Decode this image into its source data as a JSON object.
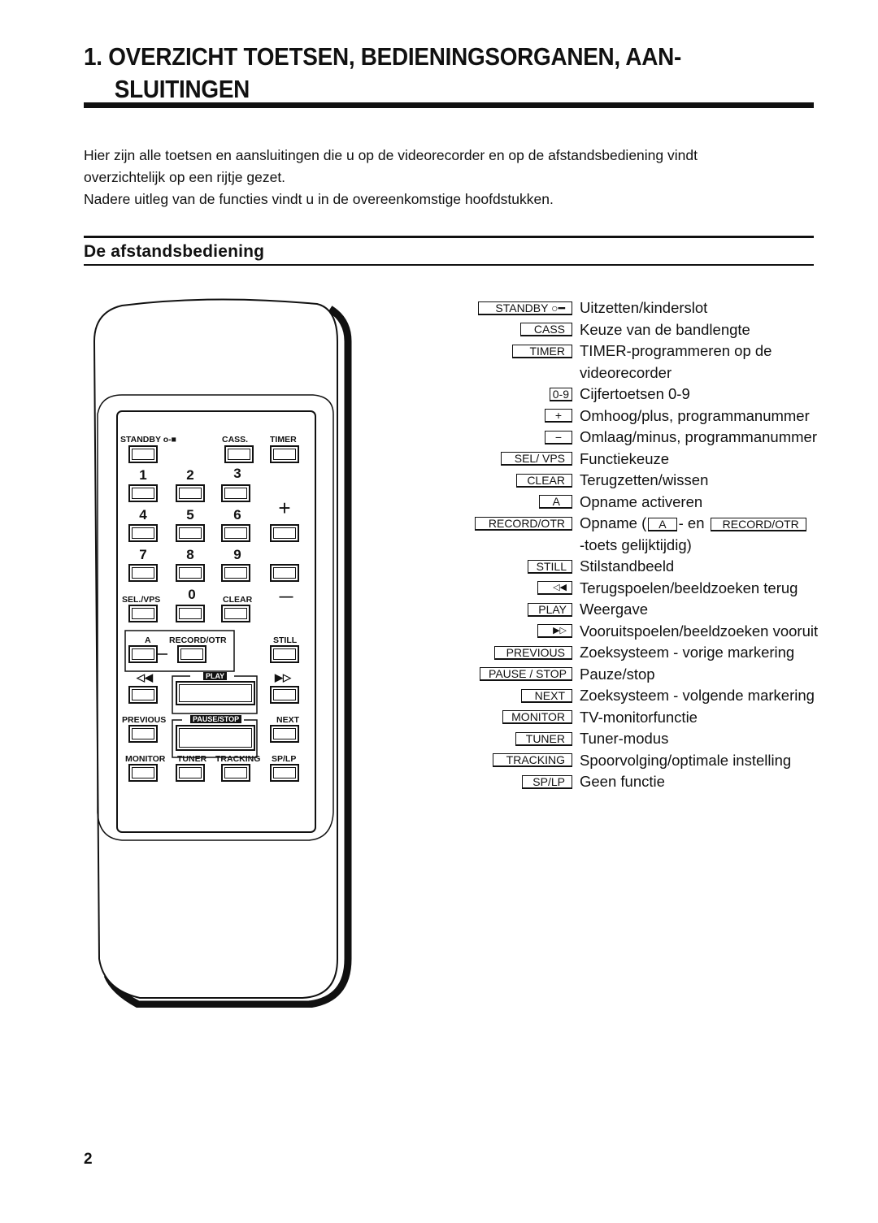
{
  "title": {
    "line1": "1. OVERZICHT TOETSEN, BEDIENINGSORGANEN, AAN-",
    "line2": "SLUITINGEN"
  },
  "intro": {
    "line1": "Hier zijn alle toetsen en aansluitingen die u op de videorecorder en op de afstandsbediening vindt",
    "line2": "overzichtelijk op een rijtje gezet.",
    "line3": "Nadere uitleg van de functies vindt u in de overeenkomstige hoofdstukken."
  },
  "section_title": "De afstandsbediening",
  "legend": [
    {
      "key": "STANDBY ⸺",
      "key_text": "STANDBY",
      "icon": "key-icon",
      "desc": "Uitzetten/kinderslot"
    },
    {
      "key_text": "CASS",
      "desc": "Keuze van de bandlengte"
    },
    {
      "key_text": "TIMER",
      "desc": "TIMER-programmeren op de"
    },
    {
      "key_text": "",
      "desc": "videorecorder"
    },
    {
      "key_text": "0-9",
      "desc": "Cijfertoetsen 0-9"
    },
    {
      "key_text": "+",
      "desc": "Omhoog/plus, programmanummer"
    },
    {
      "key_text": "−",
      "desc": "Omlaag/minus, programmanummer"
    },
    {
      "key_text": "SEL/ VPS",
      "desc": "Functiekeuze"
    },
    {
      "key_text": "CLEAR",
      "desc": "Terugzetten/wissen"
    },
    {
      "key_text": "A",
      "desc": "Opname activeren"
    },
    {
      "key_text": "RECORD/OTR",
      "desc_pre": "Opname (",
      "desc_key1": "A",
      "desc_mid": "- en",
      "desc_key2": "RECORD/OTR"
    },
    {
      "key_text": "",
      "desc": "-toets gelijktijdig)"
    },
    {
      "key_text": "STILL",
      "desc": "Stilstandbeeld"
    },
    {
      "key_text": "◁◀",
      "desc": "Terugspoelen/beeldzoeken terug"
    },
    {
      "key_text": "PLAY",
      "desc": "Weergave"
    },
    {
      "key_text": "▶▷",
      "desc": "Vooruitspoelen/beeldzoeken vooruit"
    },
    {
      "key_text": "PREVIOUS",
      "desc": "Zoeksysteem - vorige markering"
    },
    {
      "key_text": "PAUSE / STOP",
      "desc": "Pauze/stop"
    },
    {
      "key_text": "NEXT",
      "desc": "Zoeksysteem - volgende markering"
    },
    {
      "key_text": "MONITOR",
      "desc": "TV-monitorfunctie"
    },
    {
      "key_text": "TUNER",
      "desc": "Tuner-modus"
    },
    {
      "key_text": "TRACKING",
      "desc": "Spoorvolging/optimale instelling"
    },
    {
      "key_text": "SP/LP",
      "desc": "Geen functie"
    }
  ],
  "remote": {
    "standby": "STANDBY ─○",
    "standby_text": "STANDBY",
    "cass": "CASS.",
    "timer": "TIMER",
    "digits": [
      "1",
      "2",
      "3",
      "4",
      "5",
      "6",
      "7",
      "8",
      "9",
      "0"
    ],
    "plus": "+",
    "minus": "—",
    "selvps": "SEL./VPS",
    "clear": "CLEAR",
    "a": "A",
    "record": "RECORD/OTR",
    "still": "STILL",
    "rew": "◁◀",
    "ff": "▶▷",
    "play": "PLAY",
    "previous": "PREVIOUS",
    "pausestop": "PAUSE/STOP",
    "next": "NEXT",
    "monitor": "MONITOR",
    "tuner": "TUNER",
    "tracking": "TRACKING",
    "splp": "SP/LP"
  },
  "page_number": "2"
}
